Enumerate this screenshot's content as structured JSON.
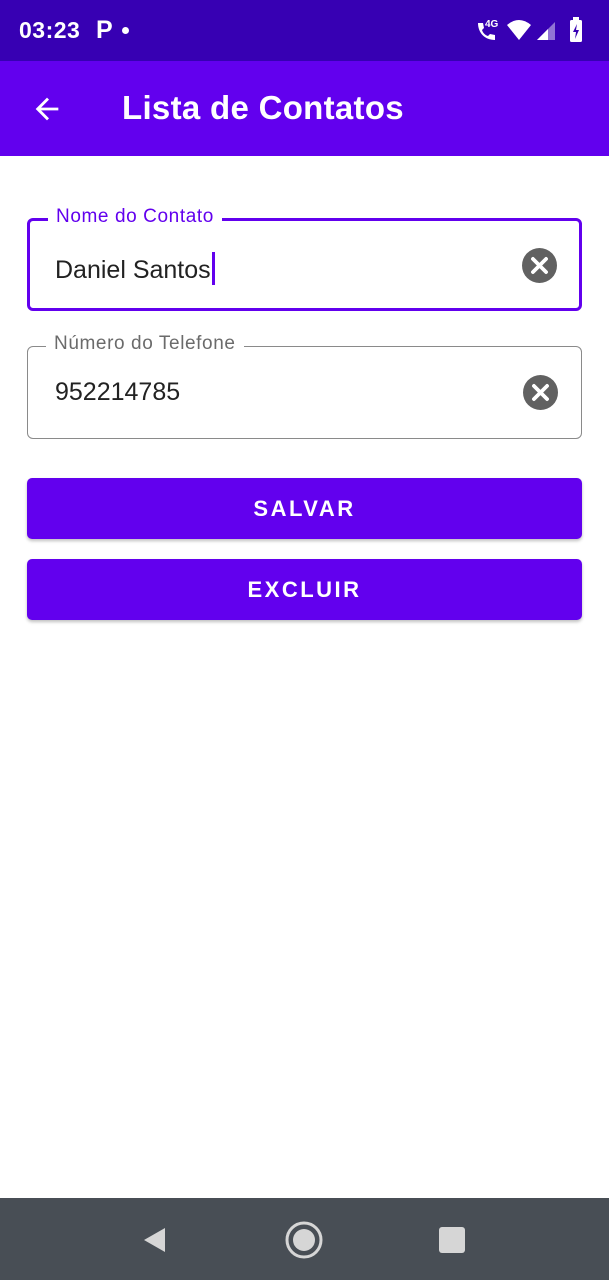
{
  "status_bar": {
    "time": "03:23",
    "notification_icon": "parking-p-icon",
    "network_label": "4G",
    "icons": [
      "call-wifi-icon",
      "wifi-icon",
      "cell-signal-icon",
      "battery-charging-icon"
    ],
    "color": "#3700b3"
  },
  "app_bar": {
    "title": "Lista de Contatos",
    "back_icon": "arrow-back-icon",
    "color": "#6200ee"
  },
  "form": {
    "name_field": {
      "label": "Nome do Contato",
      "value": "Daniel Santos",
      "focused": true,
      "clear_icon": "clear-circle-icon"
    },
    "phone_field": {
      "label": "Número do Telefone",
      "value": "952214785",
      "focused": false,
      "clear_icon": "clear-circle-icon"
    }
  },
  "buttons": {
    "save_label": "SALVAR",
    "delete_label": "EXCLUIR"
  },
  "nav_bar": {
    "buttons": [
      "back-triangle-icon",
      "home-circle-icon",
      "recents-square-icon"
    ],
    "color": "#484e55"
  },
  "colors": {
    "accent": "#6200ee",
    "accent_dark": "#3700b3"
  }
}
